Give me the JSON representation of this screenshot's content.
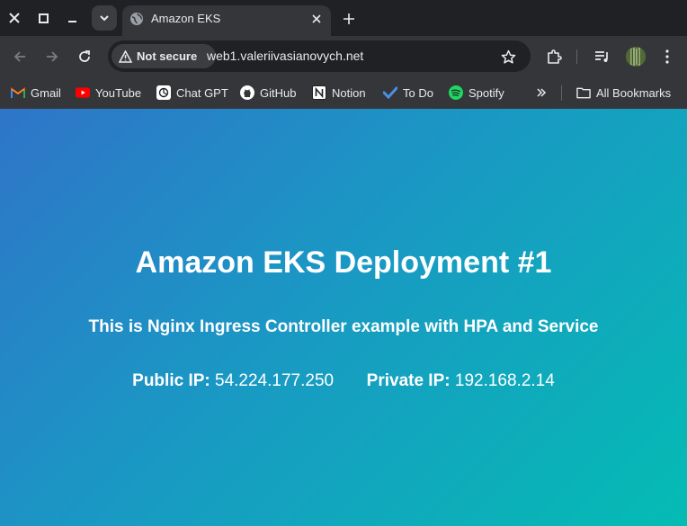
{
  "browser": {
    "tab": {
      "title": "Amazon EKS"
    },
    "address_bar": {
      "security_label": "Not secure",
      "url": "web1.valeriivasianovych.net"
    },
    "bookmarks": [
      {
        "label": "Gmail",
        "icon": "gmail-icon"
      },
      {
        "label": "YouTube",
        "icon": "youtube-icon"
      },
      {
        "label": "Chat GPT",
        "icon": "chatgpt-icon"
      },
      {
        "label": "GitHub",
        "icon": "github-icon"
      },
      {
        "label": "Notion",
        "icon": "notion-icon"
      },
      {
        "label": "To Do",
        "icon": "todo-icon"
      },
      {
        "label": "Spotify",
        "icon": "spotify-icon"
      }
    ],
    "all_bookmarks_label": "All Bookmarks"
  },
  "page": {
    "heading": "Amazon EKS Deployment #1",
    "subheading": "This is Nginx Ingress Controller example with HPA and Service",
    "public_ip_label": "Public IP:",
    "public_ip": "54.224.177.250",
    "private_ip_label": "Private IP:",
    "private_ip": "192.168.2.14"
  },
  "colors": {
    "gradient_start": "#2f75c8",
    "gradient_end": "#04bcb4",
    "chrome_dark": "#202124",
    "chrome_toolbar": "#35363a"
  }
}
